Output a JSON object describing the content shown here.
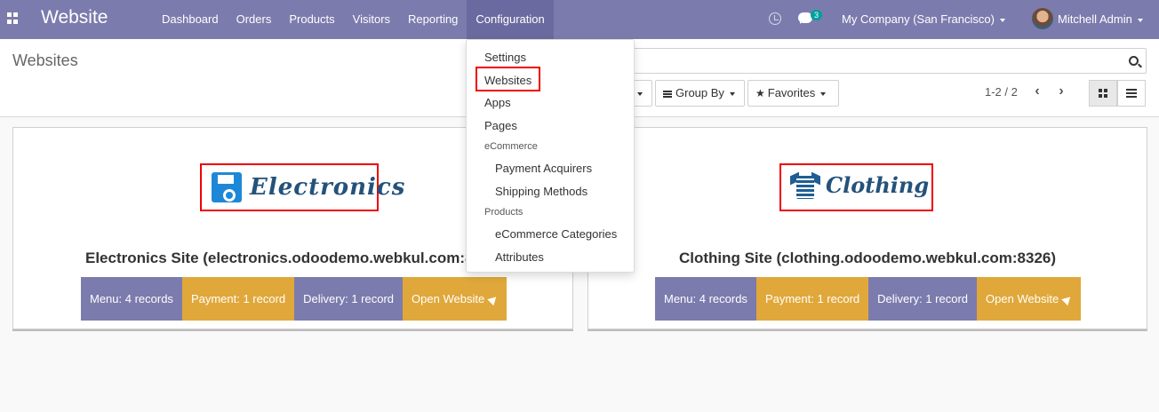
{
  "app": {
    "title": "Website",
    "menu": [
      "Dashboard",
      "Orders",
      "Products",
      "Visitors",
      "Reporting",
      "Configuration"
    ],
    "active_menu": "Configuration",
    "chat_badge": "3",
    "company": "My Company (San Francisco)",
    "user": "Mitchell Admin"
  },
  "control_panel": {
    "breadcrumb": "Websites",
    "search_placeholder": "",
    "group_by_label": "Group By",
    "favorites_label": "Favorites",
    "pager": "1-2 / 2"
  },
  "config_menu": {
    "items": [
      {
        "label": "Settings",
        "type": "item"
      },
      {
        "label": "Websites",
        "type": "item",
        "highlighted": true
      },
      {
        "label": "Apps",
        "type": "item"
      },
      {
        "label": "Pages",
        "type": "item"
      },
      {
        "label": "eCommerce",
        "type": "header"
      },
      {
        "label": "Payment Acquirers",
        "type": "subitem"
      },
      {
        "label": "Shipping Methods",
        "type": "subitem"
      },
      {
        "label": "Products",
        "type": "header"
      },
      {
        "label": "eCommerce Categories",
        "type": "subitem"
      },
      {
        "label": "Attributes",
        "type": "subitem"
      }
    ]
  },
  "websites": [
    {
      "logo_text": "Electronics",
      "logo_icon": "floppy-disk-icon",
      "name": "Electronics Site (electronics.odoodemo.webkul.com:8",
      "menu_label": "Menu: 4 records",
      "payment_label": "Payment: 1 record",
      "delivery_label": "Delivery: 1 record",
      "open_label": "Open Website"
    },
    {
      "logo_text": "Clothing",
      "logo_icon": "tshirt-icon",
      "name": "Clothing Site (clothing.odoodemo.webkul.com:8326)",
      "menu_label": "Menu: 4 records",
      "payment_label": "Payment: 1 record",
      "delivery_label": "Delivery: 1 record",
      "open_label": "Open Website"
    }
  ],
  "colors": {
    "navbar": "#7c7bad",
    "stat_purple": "#7c7bad",
    "stat_orange": "#e0a83a",
    "highlight": "#ee0000"
  }
}
